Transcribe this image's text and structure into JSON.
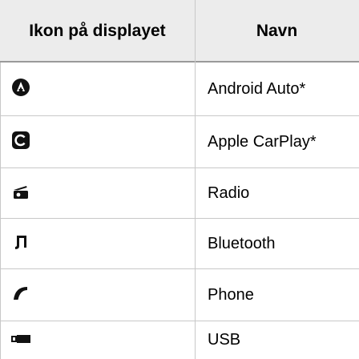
{
  "header": {
    "col_icon": "Ikon på displayet",
    "col_name": "Navn"
  },
  "rows": [
    {
      "icon": "android-auto-icon",
      "name": "Android Auto*"
    },
    {
      "icon": "apple-carplay-icon",
      "name": "Apple CarPlay*"
    },
    {
      "icon": "radio-icon",
      "name": "Radio"
    },
    {
      "icon": "bluetooth-music-icon",
      "name": "Bluetooth"
    },
    {
      "icon": "phone-icon",
      "name": "Phone"
    },
    {
      "icon": "usb-icon",
      "name": "USB"
    }
  ]
}
